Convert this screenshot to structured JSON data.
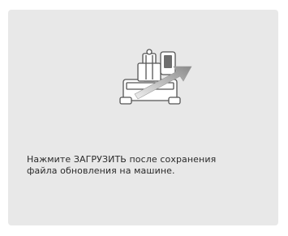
{
  "screen": {
    "message_lines": [
      "Нажмите ЗАГРУЗИТЬ после сохранения",
      "файла обновления на машине."
    ]
  },
  "illustration": {
    "icon": "machine-update-icon",
    "accent_color": "#8f8f8f"
  }
}
